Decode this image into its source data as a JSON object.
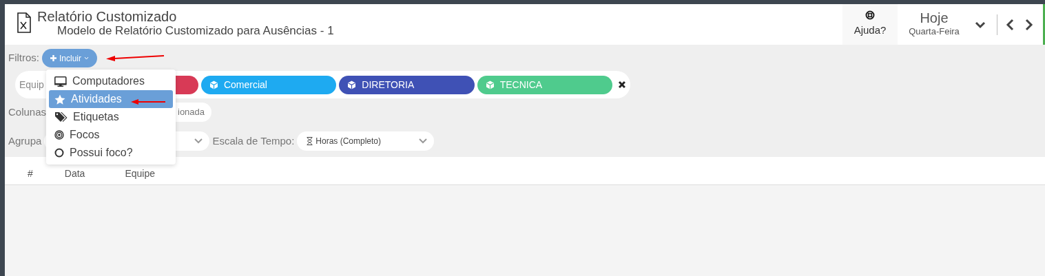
{
  "header": {
    "title": "Relatório Customizado",
    "subtitle": "Modelo de Relatório Customizado para Ausências - 1",
    "help": "Ajuda?",
    "date_title": "Hoje",
    "date_subtitle": "Quarta-Feira"
  },
  "filters": {
    "label": "Filtros:",
    "include_button": "Incluir",
    "placeholder": "Equip",
    "chips": [
      {
        "color": "#d83a56"
      },
      {
        "label": "Comercial",
        "color": "#1eaaf1"
      },
      {
        "label": "DIRETORIA",
        "color": "#3f51b5"
      },
      {
        "label": "TECNICA",
        "color": "#4fcb8d"
      }
    ]
  },
  "columns": {
    "label": "Colunas",
    "value": "ionada"
  },
  "grouping": {
    "label": "Agrupa"
  },
  "time_scale": {
    "label": "Escala de Tempo:",
    "value": "Horas (Completo)"
  },
  "dropdown": [
    {
      "label": "Computadores",
      "selected": false
    },
    {
      "label": "Atividades",
      "selected": true
    },
    {
      "label": "Etiquetas",
      "selected": false
    },
    {
      "label": "Focos",
      "selected": false
    },
    {
      "label": "Possui foco?",
      "selected": false
    }
  ],
  "table": {
    "columns": [
      "#",
      "Data",
      "Equipe"
    ]
  }
}
